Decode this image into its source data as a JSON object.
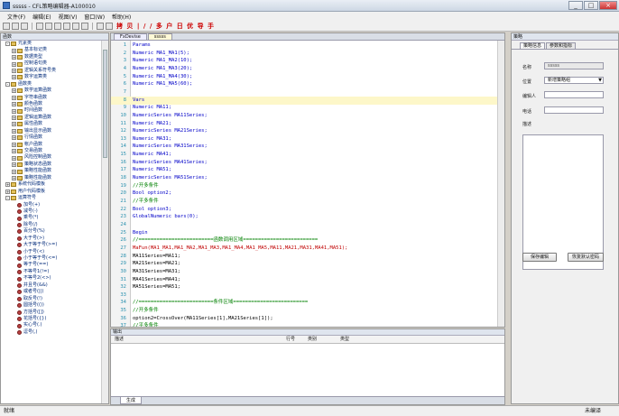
{
  "title": "sssss - CFL策略编辑器-A100010",
  "menu": [
    "文件(F)",
    "编辑(E)",
    "视图(V)",
    "窗口(W)",
    "帮助(H)"
  ],
  "toolbar_text": "拷 贝 | / / 多 户 日 优 导 手",
  "left": {
    "header": "函数",
    "tree": [
      {
        "t": "元素类",
        "lvl": 0,
        "exp": "-",
        "ic": "grp"
      },
      {
        "t": "基本标记类",
        "lvl": 1,
        "exp": "+",
        "ic": "grp"
      },
      {
        "t": "数据类型",
        "lvl": 1,
        "exp": "+",
        "ic": "grp"
      },
      {
        "t": "控制语句类",
        "lvl": 1,
        "exp": "+",
        "ic": "grp"
      },
      {
        "t": "逻辑关系符号类",
        "lvl": 1,
        "exp": "+",
        "ic": "grp"
      },
      {
        "t": "数字运算类",
        "lvl": 1,
        "exp": "+",
        "ic": "grp"
      },
      {
        "t": "函数类",
        "lvl": 0,
        "exp": "-",
        "ic": "grp"
      },
      {
        "t": "数学运算函数",
        "lvl": 1,
        "exp": "+",
        "ic": "grp"
      },
      {
        "t": "字符串函数",
        "lvl": 1,
        "exp": "+",
        "ic": "grp"
      },
      {
        "t": "颜色函数",
        "lvl": 1,
        "exp": "+",
        "ic": "grp"
      },
      {
        "t": "时间函数",
        "lvl": 1,
        "exp": "+",
        "ic": "grp"
      },
      {
        "t": "逻辑运算函数",
        "lvl": 1,
        "exp": "+",
        "ic": "grp"
      },
      {
        "t": "属性函数",
        "lvl": 1,
        "exp": "+",
        "ic": "grp"
      },
      {
        "t": "输出显示函数",
        "lvl": 1,
        "exp": "+",
        "ic": "grp"
      },
      {
        "t": "行情函数",
        "lvl": 1,
        "exp": "+",
        "ic": "grp"
      },
      {
        "t": "帐户函数",
        "lvl": 1,
        "exp": "+",
        "ic": "grp"
      },
      {
        "t": "交易函数",
        "lvl": 1,
        "exp": "+",
        "ic": "grp"
      },
      {
        "t": "风险控制函数",
        "lvl": 1,
        "exp": "+",
        "ic": "grp"
      },
      {
        "t": "策略状态函数",
        "lvl": 1,
        "exp": "+",
        "ic": "grp"
      },
      {
        "t": "策略性能函数",
        "lvl": 1,
        "exp": "+",
        "ic": "grp"
      },
      {
        "t": "策略性能函数",
        "lvl": 1,
        "exp": "+",
        "ic": "grp"
      },
      {
        "t": "系统代码模板",
        "lvl": 0,
        "exp": "+",
        "ic": "grp"
      },
      {
        "t": "用户代码模板",
        "lvl": 0,
        "exp": "+",
        "ic": "grp"
      },
      {
        "t": "运算符号",
        "lvl": 0,
        "exp": "-",
        "ic": "grp"
      },
      {
        "t": "加号(+)",
        "lvl": 1,
        "exp": "",
        "ic": "fn"
      },
      {
        "t": "减号(-)",
        "lvl": 1,
        "exp": "",
        "ic": "fn"
      },
      {
        "t": "乘号(*)",
        "lvl": 1,
        "exp": "",
        "ic": "fn"
      },
      {
        "t": "除号(/)",
        "lvl": 1,
        "exp": "",
        "ic": "fn"
      },
      {
        "t": "百分号(%)",
        "lvl": 1,
        "exp": "",
        "ic": "fn"
      },
      {
        "t": "大于号(>)",
        "lvl": 1,
        "exp": "",
        "ic": "fn"
      },
      {
        "t": "大于等于号(>=)",
        "lvl": 1,
        "exp": "",
        "ic": "fn"
      },
      {
        "t": "小于号(<)",
        "lvl": 1,
        "exp": "",
        "ic": "fn"
      },
      {
        "t": "小于等于号(<=)",
        "lvl": 1,
        "exp": "",
        "ic": "fn"
      },
      {
        "t": "等于号(==)",
        "lvl": 1,
        "exp": "",
        "ic": "fn"
      },
      {
        "t": "不等号1(!=)",
        "lvl": 1,
        "exp": "",
        "ic": "fn"
      },
      {
        "t": "不等号2(<>)",
        "lvl": 1,
        "exp": "",
        "ic": "fn"
      },
      {
        "t": "并且号(&&)",
        "lvl": 1,
        "exp": "",
        "ic": "fn"
      },
      {
        "t": "或者号(||)",
        "lvl": 1,
        "exp": "",
        "ic": "fn"
      },
      {
        "t": "取反号(!)",
        "lvl": 1,
        "exp": "",
        "ic": "fn"
      },
      {
        "t": "圆括号(())",
        "lvl": 1,
        "exp": "",
        "ic": "fn"
      },
      {
        "t": "方括号([])",
        "lvl": 1,
        "exp": "",
        "ic": "fn"
      },
      {
        "t": "花括号({})",
        "lvl": 1,
        "exp": "",
        "ic": "fn"
      },
      {
        "t": "实心号(.)",
        "lvl": 1,
        "exp": "",
        "ic": "fn"
      },
      {
        "t": "逗号(,)",
        "lvl": 1,
        "exp": "",
        "ic": "fn"
      }
    ]
  },
  "editor": {
    "tabs": [
      "FxDevise",
      "sssss"
    ],
    "lines": [
      {
        "n": "1",
        "t": "Params",
        "c": "#0000c8"
      },
      {
        "n": "2",
        "t": "Numeric MA1_MA1(5);",
        "c": "#0000c8"
      },
      {
        "n": "3",
        "t": "Numeric MA1_MA2(10);",
        "c": "#0000c8"
      },
      {
        "n": "4",
        "t": "Numeric MA1_MA3(20);",
        "c": "#0000c8"
      },
      {
        "n": "5",
        "t": "Numeric MA1_MA4(30);",
        "c": "#0000c8"
      },
      {
        "n": "6",
        "t": "Numeric MA1_MA5(60);",
        "c": "#0000c8"
      },
      {
        "n": "7",
        "t": "",
        "c": "#000"
      },
      {
        "n": "8",
        "t": "Vars",
        "c": "#0000c8",
        "hl": true
      },
      {
        "n": "9",
        "t": "Numeric MA11;",
        "c": "#0000c8"
      },
      {
        "n": "10",
        "t": "NumericSeries MA11Series;",
        "c": "#0000c8"
      },
      {
        "n": "11",
        "t": "Numeric MA21;",
        "c": "#0000c8"
      },
      {
        "n": "12",
        "t": "NumericSeries MA21Series;",
        "c": "#0000c8"
      },
      {
        "n": "13",
        "t": "Numeric MA31;",
        "c": "#0000c8"
      },
      {
        "n": "14",
        "t": "NumericSeries MA31Series;",
        "c": "#0000c8"
      },
      {
        "n": "15",
        "t": "Numeric MA41;",
        "c": "#0000c8"
      },
      {
        "n": "16",
        "t": "NumericSeries MA41Series;",
        "c": "#0000c8"
      },
      {
        "n": "17",
        "t": "Numeric MA51;",
        "c": "#0000c8"
      },
      {
        "n": "18",
        "t": "NumericSeries MA51Series;",
        "c": "#0000c8"
      },
      {
        "n": "19",
        "t": "//开多条件",
        "c": "#008000"
      },
      {
        "n": "20",
        "t": "Bool option2;",
        "c": "#0000c8"
      },
      {
        "n": "21",
        "t": "//平多条件",
        "c": "#008000"
      },
      {
        "n": "22",
        "t": "Bool option3;",
        "c": "#0000c8"
      },
      {
        "n": "23",
        "t": "GlobalNumeric bars(0);",
        "c": "#0000c8"
      },
      {
        "n": "24",
        "t": "",
        "c": "#000"
      },
      {
        "n": "25",
        "t": "Begin",
        "c": "#0000c8"
      },
      {
        "n": "26",
        "t": "//=========================函数调用区域=========================",
        "c": "#008000"
      },
      {
        "n": "27",
        "t": "MaFun(MA1_MA1,MA1_MA2,MA1_MA3,MA1_MA4,MA1_MA5,MA11,MA21,MA31,MA41,MA51);",
        "c": "#c00000"
      },
      {
        "n": "28",
        "t": "MA11Series=MA11;",
        "c": "#000"
      },
      {
        "n": "29",
        "t": "MA21Series=MA21;",
        "c": "#000"
      },
      {
        "n": "30",
        "t": "MA31Series=MA31;",
        "c": "#000"
      },
      {
        "n": "31",
        "t": "MA41Series=MA41;",
        "c": "#000"
      },
      {
        "n": "32",
        "t": "MA51Series=MA51;",
        "c": "#000"
      },
      {
        "n": "33",
        "t": "",
        "c": "#000"
      },
      {
        "n": "34",
        "t": "//=========================条件区域=========================",
        "c": "#008000"
      },
      {
        "n": "35",
        "t": "//开多条件",
        "c": "#008000"
      },
      {
        "n": "36",
        "t": "option2=CrossOver(MA11Series[1],MA21Series[1]);",
        "c": "#000"
      },
      {
        "n": "37",
        "t": "//平多条件",
        "c": "#008000"
      }
    ]
  },
  "output": {
    "header": "输出",
    "cols": [
      "描述",
      "行号",
      "类别",
      "类型"
    ],
    "tab": "生成"
  },
  "right": {
    "header": "策略",
    "tabs": [
      "策略信息",
      "参数和指标"
    ],
    "name_label": "名称",
    "name_value": "sssss",
    "pos_label": "位置",
    "pos_value": "新增策略组",
    "author_label": "编辑人",
    "phone_label": "电话",
    "desc_label": "描述",
    "save_btn": "保存编辑",
    "reset_btn": "恢复默认密码"
  },
  "status": {
    "left": "就绪",
    "right": "未编译"
  }
}
